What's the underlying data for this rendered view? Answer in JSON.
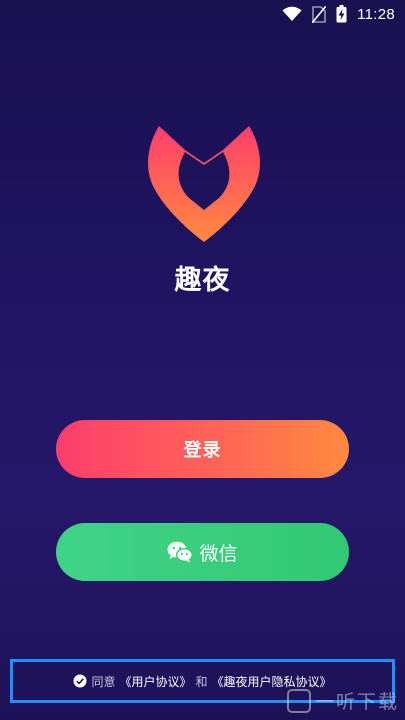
{
  "status_bar": {
    "time": "11:28",
    "icons": [
      "wifi-icon",
      "no-sim-icon",
      "battery-charging-icon"
    ]
  },
  "app": {
    "name": "趣夜",
    "logo_icon": "heart-fox-logo",
    "colors": {
      "background_top": "#1a1150",
      "background_bottom": "#26186a",
      "logo_top": "#fd3d6d",
      "logo_bottom": "#ff8a3e"
    }
  },
  "buttons": {
    "login_label": "登录",
    "login_colors": [
      "#fd3d6d",
      "#ff8a3e"
    ],
    "wechat_label": "微信",
    "wechat_icon": "wechat-icon",
    "wechat_color": "#34cb79"
  },
  "agreement": {
    "checked": true,
    "prefix": "同意",
    "user_agreement": "《用户协议》",
    "conjunction": "和",
    "privacy_agreement": "《趣夜用户隐私协议》"
  },
  "watermark": {
    "text": "一听下载"
  }
}
